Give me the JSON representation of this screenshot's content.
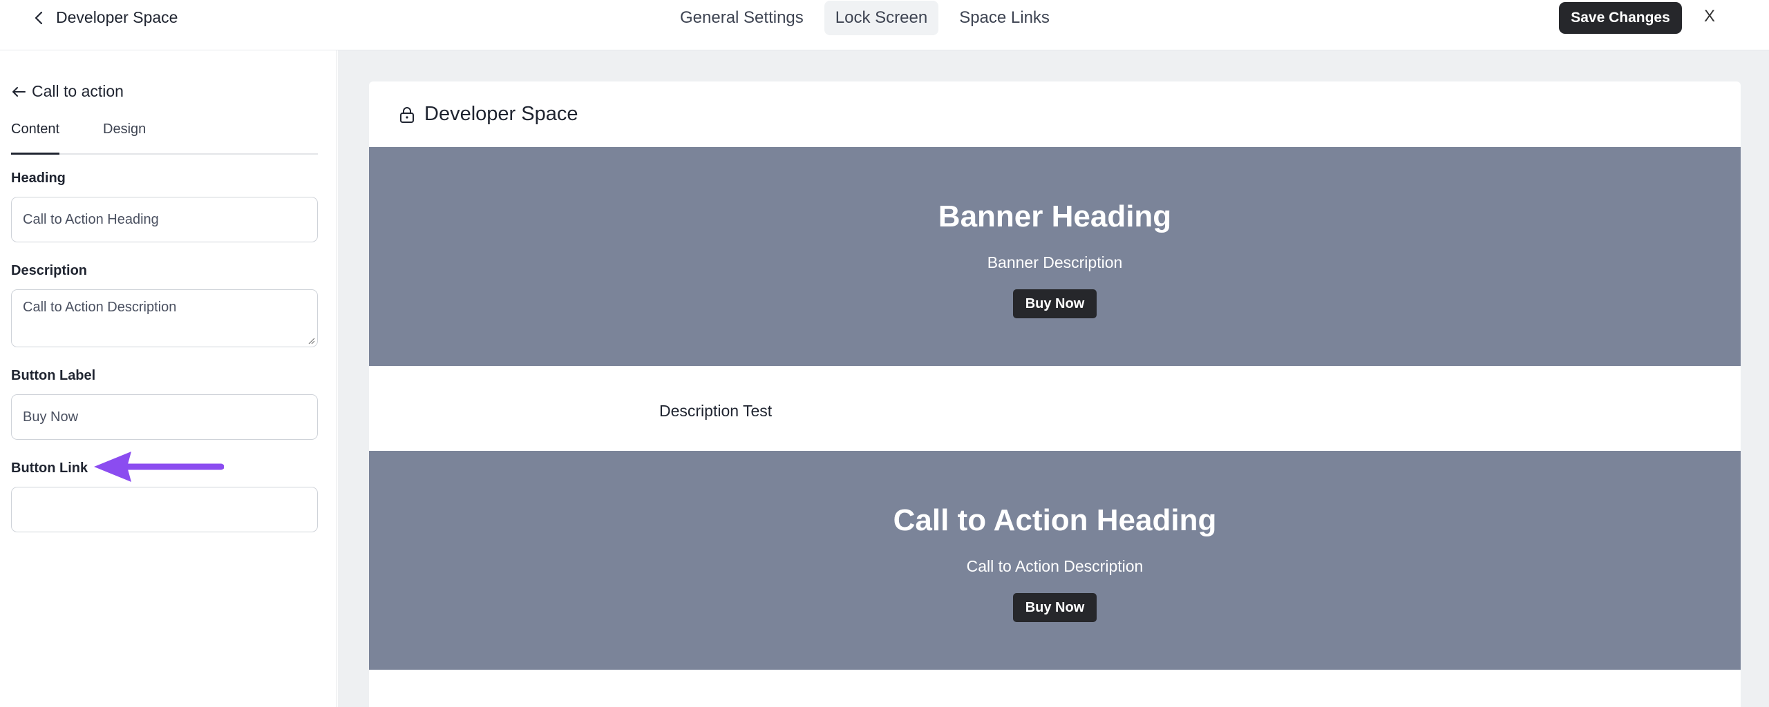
{
  "header": {
    "title": "Developer Space",
    "tabs": [
      {
        "label": "General Settings"
      },
      {
        "label": "Lock Screen"
      },
      {
        "label": "Space Links"
      }
    ],
    "active_tab": "Lock Screen",
    "save_label": "Save Changes",
    "close_label": "X"
  },
  "sidebar": {
    "section_title": "Call to action",
    "tabs": [
      {
        "label": "Content"
      },
      {
        "label": "Design"
      }
    ],
    "active_tab": "Content",
    "fields": {
      "heading": {
        "label": "Heading",
        "value": "Call to Action Heading"
      },
      "description": {
        "label": "Description",
        "value": "Call to Action Description"
      },
      "button_label": {
        "label": "Button Label",
        "value": "Buy Now"
      },
      "button_link": {
        "label": "Button Link",
        "value": ""
      }
    },
    "annotation": {
      "type": "arrow",
      "color": "#8b4cf0",
      "points_to": "Button Link"
    }
  },
  "preview": {
    "title": "Developer Space",
    "banner": {
      "heading": "Banner Heading",
      "description": "Banner Description",
      "button": "Buy Now"
    },
    "description_text": "Description Test",
    "cta": {
      "heading": "Call to Action Heading",
      "description": "Call to Action Description",
      "button": "Buy Now"
    },
    "colors": {
      "banner_bg": "#7b8499",
      "button_bg": "#26272b",
      "preview_bg": "#eef0f2"
    }
  }
}
